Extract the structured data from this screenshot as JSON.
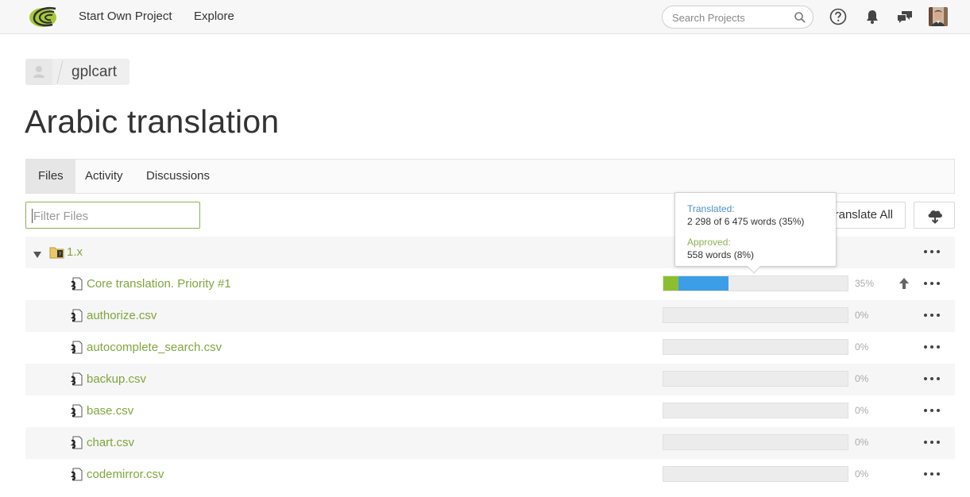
{
  "nav": {
    "start_project": "Start Own Project",
    "explore": "Explore",
    "search_placeholder": "Search Projects"
  },
  "icons": {
    "logo": "crowdin-logo-icon",
    "search": "magnifier-icon",
    "help": "question-circle-icon",
    "notifications": "bell-icon",
    "messages": "chat-bubbles-icon",
    "upload": "arrow-up-icon",
    "download": "cloud-download-icon"
  },
  "breadcrumb": {
    "project": "gplcart"
  },
  "page": {
    "title": "Arabic translation"
  },
  "tabs": [
    {
      "label": "Files",
      "active": true
    },
    {
      "label": "Activity",
      "active": false
    },
    {
      "label": "Discussions",
      "active": false
    }
  ],
  "toolbar": {
    "filter_placeholder": "Filter Files",
    "translate_all_label": "Translate All"
  },
  "tooltip": {
    "translated_label": "Translated:",
    "translated_value": "2 298 of 6 475 words (35%)",
    "approved_label": "Approved:",
    "approved_value": "558 words (8%)"
  },
  "folder": {
    "name": "1.x"
  },
  "files": [
    {
      "name": "Core translation. Priority #1",
      "pct_label": "35%",
      "translated": 0.35,
      "approved": 0.08,
      "has_upload": true
    },
    {
      "name": "authorize.csv",
      "pct_label": "0%",
      "translated": 0,
      "approved": 0,
      "has_upload": false
    },
    {
      "name": "autocomplete_search.csv",
      "pct_label": "0%",
      "translated": 0,
      "approved": 0,
      "has_upload": false
    },
    {
      "name": "backup.csv",
      "pct_label": "0%",
      "translated": 0,
      "approved": 0,
      "has_upload": false
    },
    {
      "name": "base.csv",
      "pct_label": "0%",
      "translated": 0,
      "approved": 0,
      "has_upload": false
    },
    {
      "name": "chart.csv",
      "pct_label": "0%",
      "translated": 0,
      "approved": 0,
      "has_upload": false
    },
    {
      "name": "codemirror.csv",
      "pct_label": "0%",
      "translated": 0,
      "approved": 0,
      "has_upload": false
    }
  ],
  "colors": {
    "accent_green": "#7ea63c",
    "approved_green": "#8bbf30",
    "translated_blue": "#3d9ee8",
    "tooltip_translated_label": "#4a90c8",
    "tooltip_approved_label": "#8bb152"
  }
}
